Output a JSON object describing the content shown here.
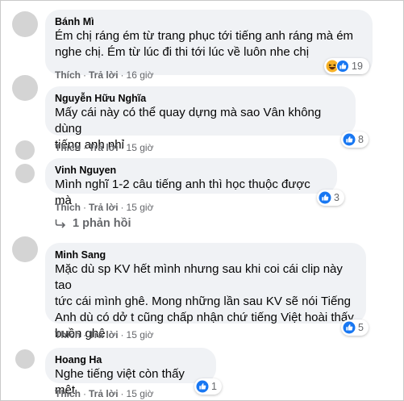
{
  "comments": [
    {
      "name": "Bánh Mì",
      "lines": [
        "Ém chị ráng ém từ trang phục tới tiếng anh ráng mà ém",
        "nghe chị. Ém từ lúc đi thi tới lúc về luôn nhe chị"
      ],
      "like": "Thích",
      "reply": "Trả lời",
      "time": "16 giờ",
      "reaction_count": "19",
      "reactions": [
        "haha-icon",
        "like-icon"
      ]
    },
    {
      "name": "Nguyễn Hữu Nghĩa",
      "lines": [
        "Mấy cái này có thể quay dựng mà sao Vân không dùng",
        "tiếng anh nhỉ"
      ],
      "like": "Thích",
      "reply": "Trả lời",
      "time": "15 giờ",
      "reaction_count": "8",
      "reactions": [
        "like-icon"
      ]
    },
    {
      "name": "Vinh Nguyen",
      "lines": [
        "Mình nghĩ 1-2 câu tiếng anh thì học thuộc được mà"
      ],
      "like": "Thích",
      "reply": "Trả lời",
      "time": "15 giờ",
      "reaction_count": "3",
      "reactions": [
        "like-icon"
      ]
    },
    {
      "name": "Minh Sang",
      "lines": [
        "Mặc dù sp KV hết mình nhưng sau khi coi cái clip này tao",
        "tức cái mình ghê. Mong những lần sau KV sẽ nói Tiếng",
        "Anh dù có dở t cũng chấp nhận chứ tiếng Việt hoài thấy",
        "buồn ghê"
      ],
      "like": "Thích",
      "reply": "Trả lời",
      "time": "15 giờ",
      "reaction_count": "5",
      "reactions": [
        "like-icon"
      ]
    },
    {
      "name": "Hoang Ha",
      "lines": [
        "Nghe tiếng việt còn thấy mệt"
      ],
      "like": "Thích",
      "reply": "Trả lời",
      "time": "15 giờ",
      "reaction_count": "1",
      "reactions": [
        "like-icon"
      ]
    }
  ],
  "view_replies": "1 phản hồi",
  "colors": {
    "bubble": "#f0f2f5",
    "like_blue": "#1877f2",
    "haha_yellow": "#f7b125",
    "meta_gray": "#65676b"
  }
}
